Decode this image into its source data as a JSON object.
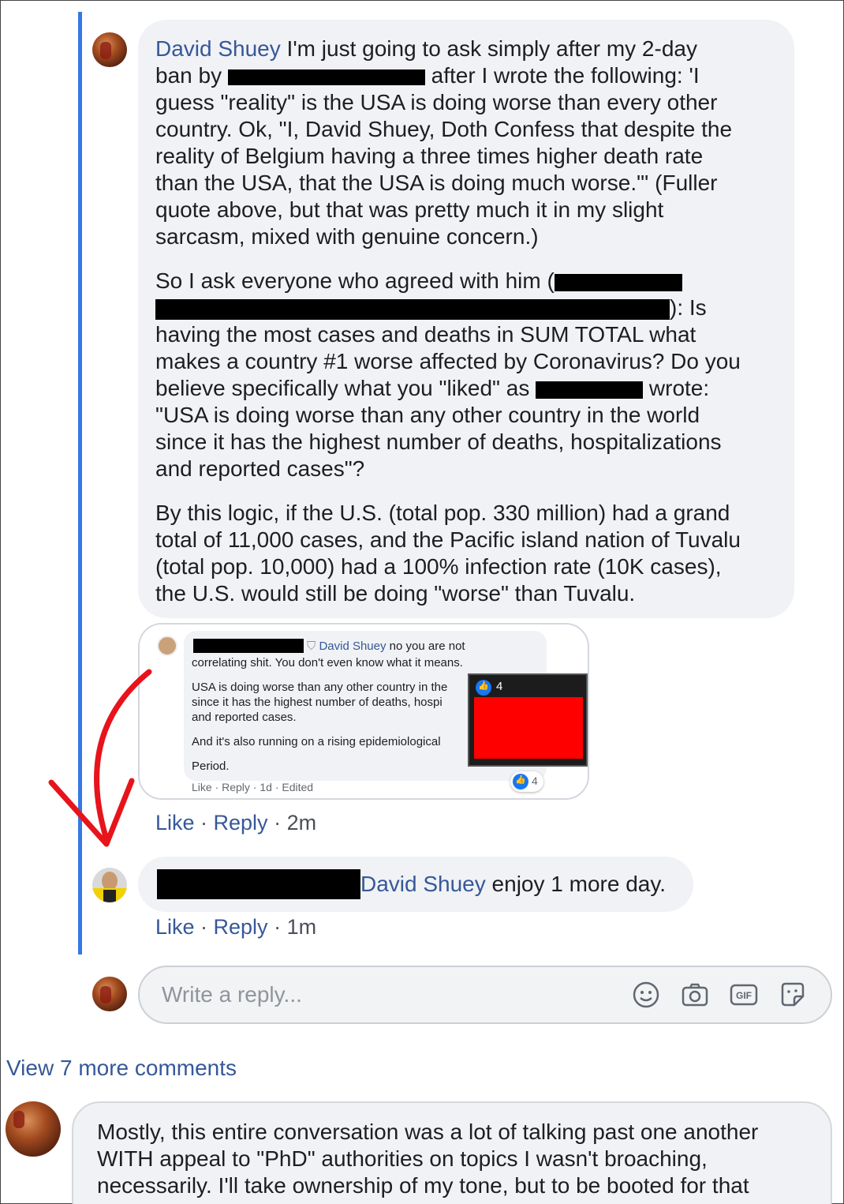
{
  "post": {
    "author": "David Shuey",
    "paragraph1_a": "I'm just going to ask simply after my 2-day",
    "paragraph1_b": "ban by",
    "paragraph1_c": "after I wrote the following: 'I",
    "paragraph1_lines": [
      "guess \"reality\" is the USA is doing worse than every other",
      "country. Ok, \"I, David Shuey, Doth Confess that despite the",
      "reality of Belgium having a three times higher death rate",
      "than the USA, that the USA is doing much worse.\"' (Fuller",
      "quote above, but that was pretty much it in my slight",
      "sarcasm, mixed with genuine concern.)"
    ],
    "paragraph2_a": "So I ask everyone who agreed with him (",
    "paragraph2_b": "): Is",
    "paragraph2_lines": [
      "having the most cases and deaths in SUM TOTAL what",
      "makes a country #1 worse affected by Coronavirus? Do you"
    ],
    "paragraph2_c": "believe specifically what you \"liked\" as",
    "paragraph2_d": "wrote:",
    "paragraph2_lines_end": [
      "\"USA is doing worse than any other country in the world",
      "since it has the highest number of deaths, hospitalizations",
      "and reported cases\"?"
    ],
    "paragraph3_lines": [
      "By this logic, if the U.S. (total pop. 330 million) had a grand",
      "total of 11,000 cases, and the Pacific island nation of Tuvalu",
      "(total pop. 10,000) had a 100% infection rate (10K cases),",
      "the U.S. would still be doing \"worse\" than Tuvalu."
    ],
    "actions": {
      "like": "Like",
      "reply": "Reply",
      "time": "2m"
    }
  },
  "embedded_screenshot": {
    "tagged_name": "David Shuey",
    "line1_rest": "no you are not",
    "lines": [
      "correlating shit. You don't even know what it means.",
      "USA is doing worse than any other country in the",
      "since it has the highest number of deaths, hospi",
      "and reported cases.",
      "And it's also running on a rising epidemiological",
      "Period."
    ],
    "meta": "Like · Reply · 1d · Edited",
    "popup_count": "4",
    "reaction_count": "4"
  },
  "reply": {
    "tagged_name": "David Shuey",
    "text": "enjoy 1 more day.",
    "actions": {
      "like": "Like",
      "reply": "Reply",
      "time": "1m"
    }
  },
  "composer": {
    "placeholder": "Write a reply..."
  },
  "view_more": "View 7 more comments",
  "bottom_comment": {
    "lines": [
      "Mostly, this entire conversation was a lot of talking past one another",
      "WITH appeal to \"PhD\" authorities on topics I wasn't broaching,",
      "necessarily. I'll take ownership of my tone, but to be booted for that"
    ]
  },
  "colors": {
    "thread_line": "#3578e5",
    "link": "#365899",
    "bubble": "#f0f2f5",
    "annotation_arrow": "#e8131b",
    "redaction": "#000000",
    "red_box": "#ff0000"
  }
}
